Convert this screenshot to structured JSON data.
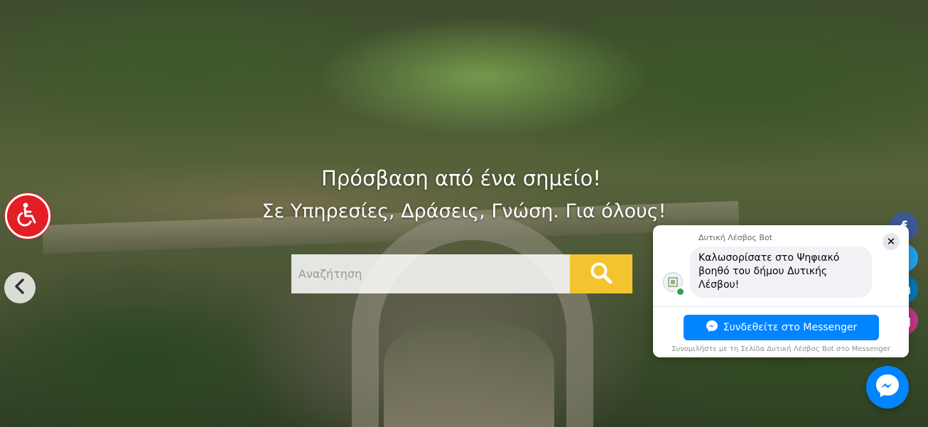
{
  "hero": {
    "title_line1": "Πρόσβαση από ένα σημείο!",
    "title_line2": "Σε Υπηρεσίες, Δράσεις, Γνώση. Για όλους!"
  },
  "search": {
    "placeholder": "Αναζήτηση",
    "button_icon": "search-icon"
  },
  "accessibility": {
    "icon": "wheelchair-icon"
  },
  "carousel": {
    "prev_icon": "chevron-left-icon"
  },
  "social": [
    {
      "name": "facebook",
      "glyph": "f"
    },
    {
      "name": "twitter",
      "glyph": "t"
    },
    {
      "name": "linkedin",
      "glyph": "in"
    },
    {
      "name": "instagram",
      "glyph": "ig"
    }
  ],
  "chat": {
    "bot_name": "Δυτική Λέσβος Bot",
    "message": "Καλωσορίσατε στο Ψηφιακό βοηθό του δήμου Δυτικής Λέσβου!",
    "close_glyph": "✕",
    "connect_label": "Συνδεθείτε στο Messenger",
    "footer_note": "Συνομιλήστε με τη Σελίδα Δυτική Λέσβος Bot στο Messenger"
  },
  "colors": {
    "search_button": "#f4c430",
    "accessibility": "#e31e24",
    "messenger": "#0084ff"
  }
}
